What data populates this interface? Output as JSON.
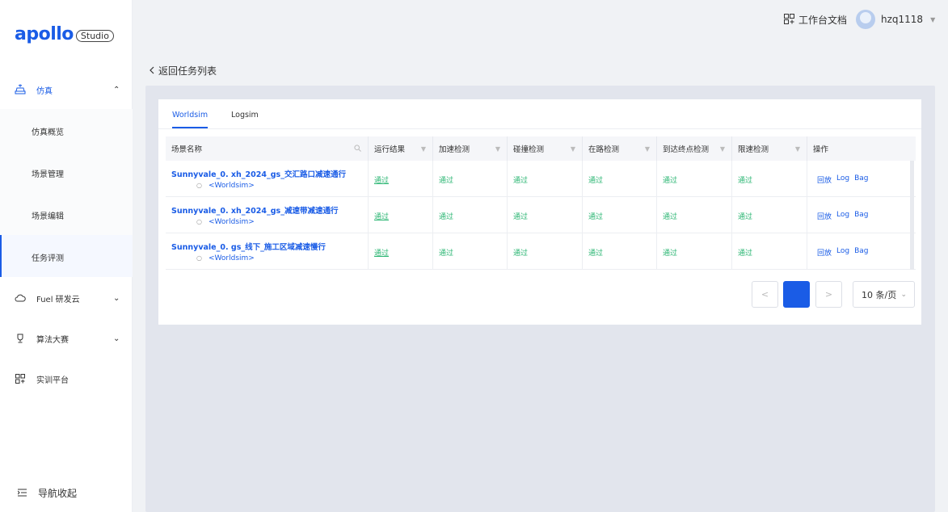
{
  "brand": {
    "logo_text": "apollo",
    "badge": "Studio"
  },
  "sidebar": {
    "simulation": {
      "label": "仿真",
      "chevron": "⌃"
    },
    "sub_items": [
      {
        "label": "仿真概览"
      },
      {
        "label": "场景管理"
      },
      {
        "label": "场景编辑"
      },
      {
        "label": "任务评测"
      }
    ],
    "fuel": {
      "label": "Fuel 研发云",
      "chevron": "⌄"
    },
    "contest": {
      "label": "算法大赛",
      "chevron": "⌄"
    },
    "training": {
      "label": "实训平台"
    },
    "collapse": {
      "label": "导航收起"
    }
  },
  "header": {
    "docs_label": "工作台文档",
    "username": "hzq1118"
  },
  "back": {
    "label": "返回任务列表"
  },
  "tabs": [
    {
      "label": "Worldsim"
    },
    {
      "label": "Logsim"
    }
  ],
  "table": {
    "headers": [
      "场景名称",
      "运行结果",
      "加速检测",
      "碰撞检测",
      "在路检测",
      "到达终点检测",
      "限速检测",
      "操作"
    ],
    "rows": [
      {
        "name": "Sunnyvale_0. xh_2024_gs_交汇路口减速通行",
        "type": "<Worldsim>",
        "results": [
          "通过",
          "通过",
          "通过",
          "通过",
          "通过",
          "通过"
        ],
        "ops": [
          "回放",
          "Log",
          "Bag"
        ]
      },
      {
        "name": "Sunnyvale_0. xh_2024_gs_减速带减速通行",
        "type": "<Worldsim>",
        "results": [
          "通过",
          "通过",
          "通过",
          "通过",
          "通过",
          "通过"
        ],
        "ops": [
          "回放",
          "Log",
          "Bag"
        ]
      },
      {
        "name": "Sunnyvale_0. gs_线下_施工区域减速慢行",
        "type": "<Worldsim>",
        "results": [
          "通过",
          "通过",
          "通过",
          "通过",
          "通过",
          "通过"
        ],
        "ops": [
          "回放",
          "Log",
          "Bag"
        ]
      }
    ]
  },
  "pagination": {
    "prev": "<",
    "next": ">",
    "page_size": "10 条/页"
  },
  "colors": {
    "accent": "#1a5ce6",
    "pass": "#2bb673"
  }
}
